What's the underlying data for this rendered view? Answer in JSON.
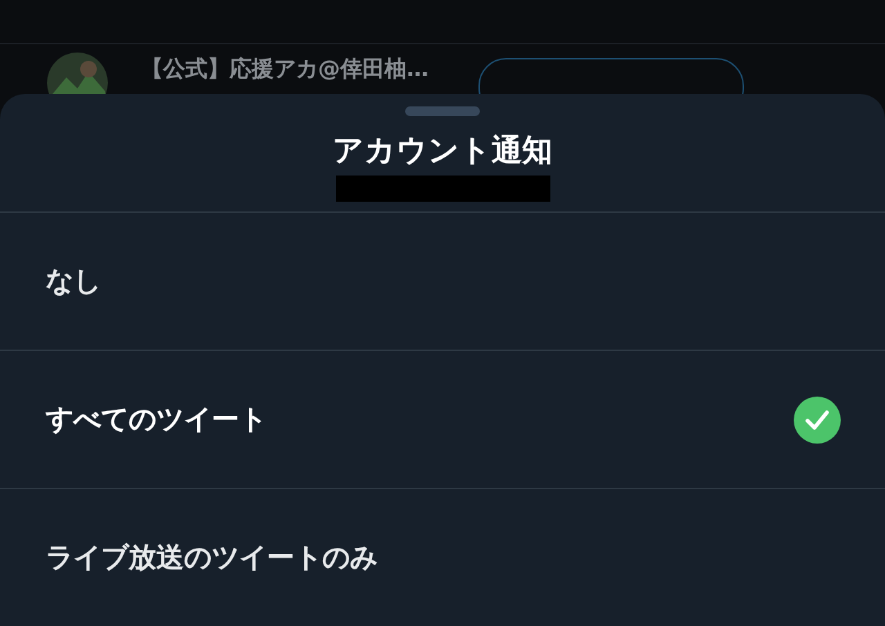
{
  "background": {
    "account_name": "【公式】応援アカ@倖田柚…"
  },
  "sheet": {
    "title": "アカウント通知",
    "options": [
      {
        "label": "なし",
        "selected": false
      },
      {
        "label": "すべてのツイート",
        "selected": true
      },
      {
        "label": "ライブ放送のツイートのみ",
        "selected": false
      }
    ]
  }
}
